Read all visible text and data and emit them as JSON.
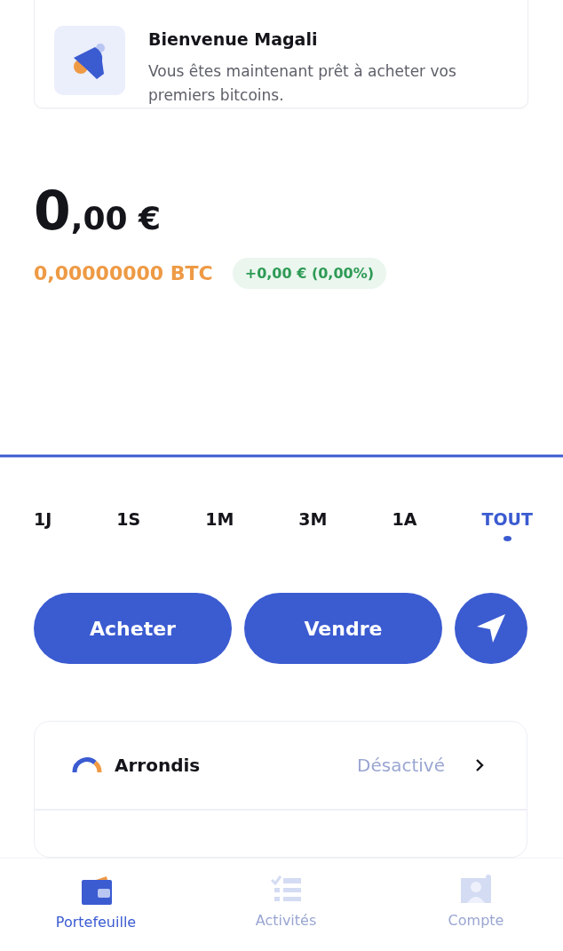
{
  "welcome_card": {
    "title": "Bienvenue Magali",
    "message": "Vous êtes maintenant prêt à acheter vos premiers bitcoins."
  },
  "balance": {
    "integer": "0",
    "decimals": ",00 €",
    "btc": "0,00000000 BTC",
    "change": "+0,00 € (0,00%)"
  },
  "periods": [
    {
      "label": "1J",
      "selected": false
    },
    {
      "label": "1S",
      "selected": false
    },
    {
      "label": "1M",
      "selected": false
    },
    {
      "label": "3M",
      "selected": false
    },
    {
      "label": "1A",
      "selected": false
    },
    {
      "label": "TOUT",
      "selected": true
    }
  ],
  "actions": [
    {
      "kind": "text",
      "label": "Acheter"
    },
    {
      "kind": "text",
      "label": "Vendre"
    },
    {
      "kind": "send"
    }
  ],
  "settings": [
    {
      "label": "Arrondis",
      "status": "Désactivé",
      "enabled": false
    }
  ],
  "bottom_nav": [
    {
      "label": "Portefeuille",
      "selected": true,
      "kind": "wallet"
    },
    {
      "label": "Activités",
      "selected": false,
      "kind": "list"
    },
    {
      "label": "Compte",
      "selected": false,
      "kind": "account"
    }
  ]
}
